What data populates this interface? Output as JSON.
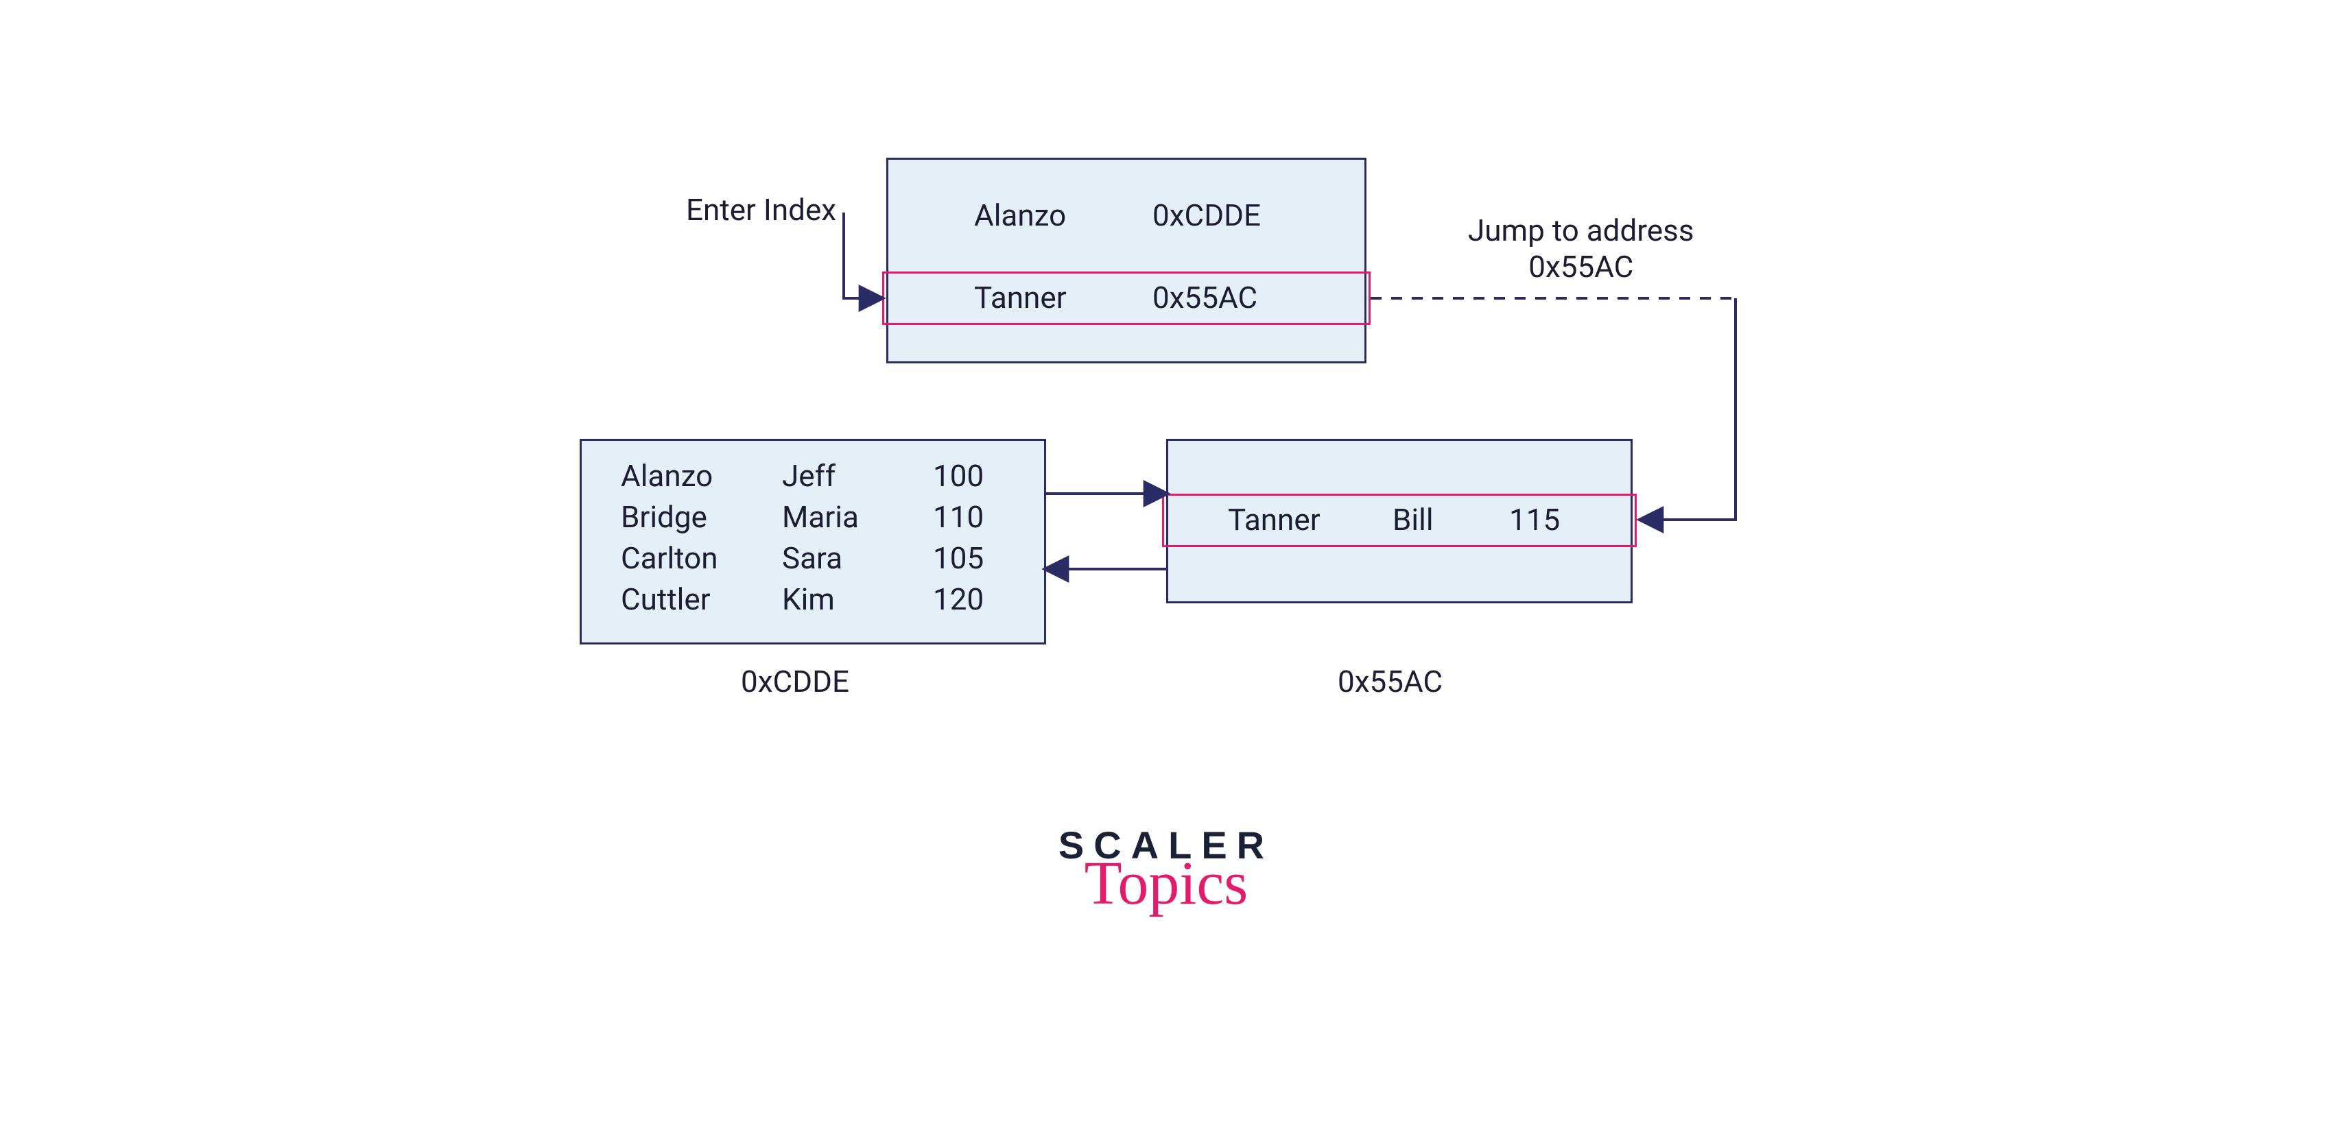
{
  "labels": {
    "enter_index": "Enter Index",
    "jump_to": "Jump to address\n0x55AC"
  },
  "index_box": {
    "rows": [
      {
        "name": "Alanzo",
        "addr": "0xCDDE"
      },
      {
        "name": "Tanner",
        "addr": "0x55AC"
      }
    ]
  },
  "block_cdde": {
    "address_label": "0xCDDE",
    "rows": [
      {
        "c0": "Alanzo",
        "c1": "Jeff",
        "c2": "100"
      },
      {
        "c0": "Bridge",
        "c1": "Maria",
        "c2": "110"
      },
      {
        "c0": "Carlton",
        "c1": "Sara",
        "c2": "105"
      },
      {
        "c0": "Cuttler",
        "c1": "Kim",
        "c2": "120"
      }
    ]
  },
  "block_55ac": {
    "address_label": "0x55AC",
    "row": {
      "c0": "Tanner",
      "c1": "Bill",
      "c2": "115"
    }
  },
  "logo": {
    "line1": "SCALER",
    "line2": "Topics"
  },
  "colors": {
    "box_fill": "#e5eff8",
    "box_border": "#2b2b66",
    "highlight": "#e31b6d",
    "text": "#1c1c33"
  }
}
